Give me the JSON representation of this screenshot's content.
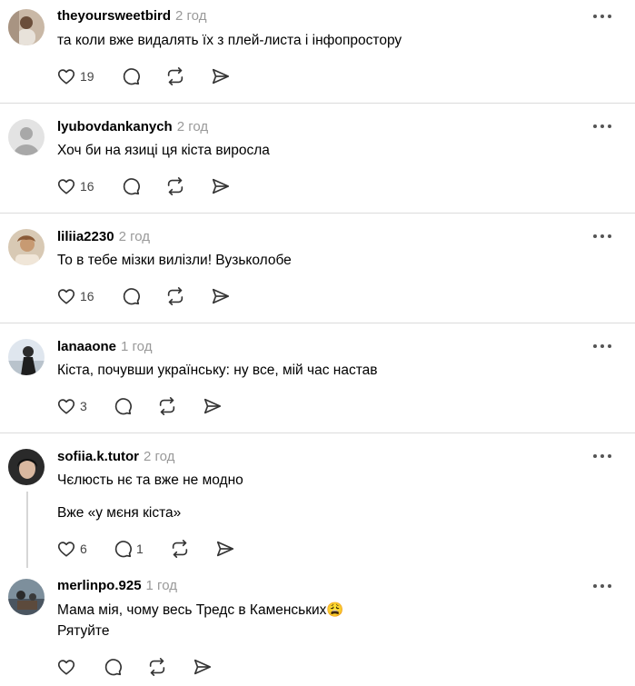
{
  "comments": [
    {
      "username": "theyoursweetbird",
      "time": "2 год",
      "lines": [
        "та коли вже видалять їх з плей-листа і інфопростору"
      ],
      "likes": "19",
      "replies": ""
    },
    {
      "username": "lyubovdankanych",
      "time": "2 год",
      "lines": [
        "Хоч би на язиці ця кіста виросла"
      ],
      "likes": "16",
      "replies": ""
    },
    {
      "username": "liliia2230",
      "time": "2 год",
      "lines": [
        "То в тебе мізки вилізли! Вузьколобе"
      ],
      "likes": "16",
      "replies": ""
    },
    {
      "username": "lanaaone",
      "time": "1 год",
      "lines": [
        "Кіста, почувши українську: ну все, мій час настав"
      ],
      "likes": "3",
      "replies": ""
    },
    {
      "username": "sofiia.k.tutor",
      "time": "2 год",
      "lines": [
        "Чєлюсть нє та вже не модно",
        "Вже «у мєня кіста»"
      ],
      "likes": "6",
      "replies": "1"
    },
    {
      "username": "merlinpo.925",
      "time": "1 год",
      "lines": [
        "Мама мія, чому весь Тредс в Каменських😩",
        "Рятуйте"
      ],
      "likes": "",
      "replies": ""
    }
  ],
  "icons": {
    "like": "heart-icon",
    "reply": "comment-bubble-icon",
    "repost": "repost-icon",
    "share": "send-icon",
    "more": "more-dots-icon"
  },
  "colors": {
    "divider": "#dbdbdb",
    "timestamp": "#999999",
    "icon": "#333333"
  }
}
